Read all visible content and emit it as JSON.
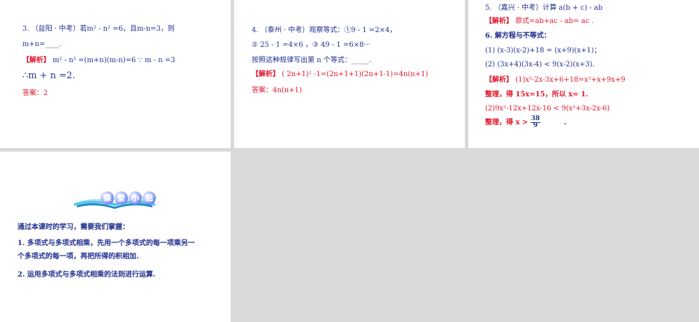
{
  "slide1": {
    "q_line1": "3. （益阳 · 中考）若m² - n² =6，且m-n=3，则",
    "q_line2": "m+n=____.",
    "jiexi_tag": "【解析】",
    "jiexi_text": "m² - n² =(m+n)(m-n)=6 ∵ m - n =3",
    "conclusion": "∴m + n =2.",
    "answer": "答案：2"
  },
  "slide2": {
    "q_line1": "4. （泰州 · 中考）观察等式：①9 - 1 =2×4，",
    "q_line2": "② 25 - 1 =4×6 ，③ 49 - 1 =6×8···",
    "q_line3": "按照这种规律写出第 n 个等式：_____.",
    "jiexi_tag": "【解析】",
    "jiexi_text": "( 2n+1)² -1=(2n+1+1)(2n+1-1)=4n(n+1)",
    "answer": "答案：4n(n+1)"
  },
  "slide3": {
    "q5": "5. （嘉兴 · 中考）计算  a(b + c) - ab",
    "q5_tag": "【解析】",
    "q5_jiexi": "原式=ab+ac - ab= ac .",
    "q6": "6. 解方程与不等式：",
    "q6_1": "(1) (x-3)(x-2)+18 = (x+9)(x+1)；",
    "q6_2": "(2) (3x+4)(3x-4)   < 9(x-2)(x+3).",
    "jiexi_tag": "【解析】",
    "jiexi1": "(1)x²-2x-3x+6+18=x²+x+9x+9",
    "zhengli1": "整理，得  15x=15，所以 x= 1.",
    "jiexi2": "(2)9x²-12x+12x-16   <   9(x²+3x-2x-6)",
    "zhengli2_prefix": "整理，得  x >",
    "frac_num": "38",
    "frac_den": "9",
    "zhengli2_suffix": "."
  },
  "slide4": {
    "banner_chars": [
      "课",
      "堂",
      "小",
      "结"
    ],
    "intro": "通过本课时的学习，需要我们掌握：",
    "point1_line1": "1. 多项式与多项式相乘，先用一个多项式的每一项乘另一",
    "point1_line2": "个多项式的每一项，再把所得的积相加.",
    "point2": "2.   运用多项式与多项式相乘的法则进行运算."
  }
}
